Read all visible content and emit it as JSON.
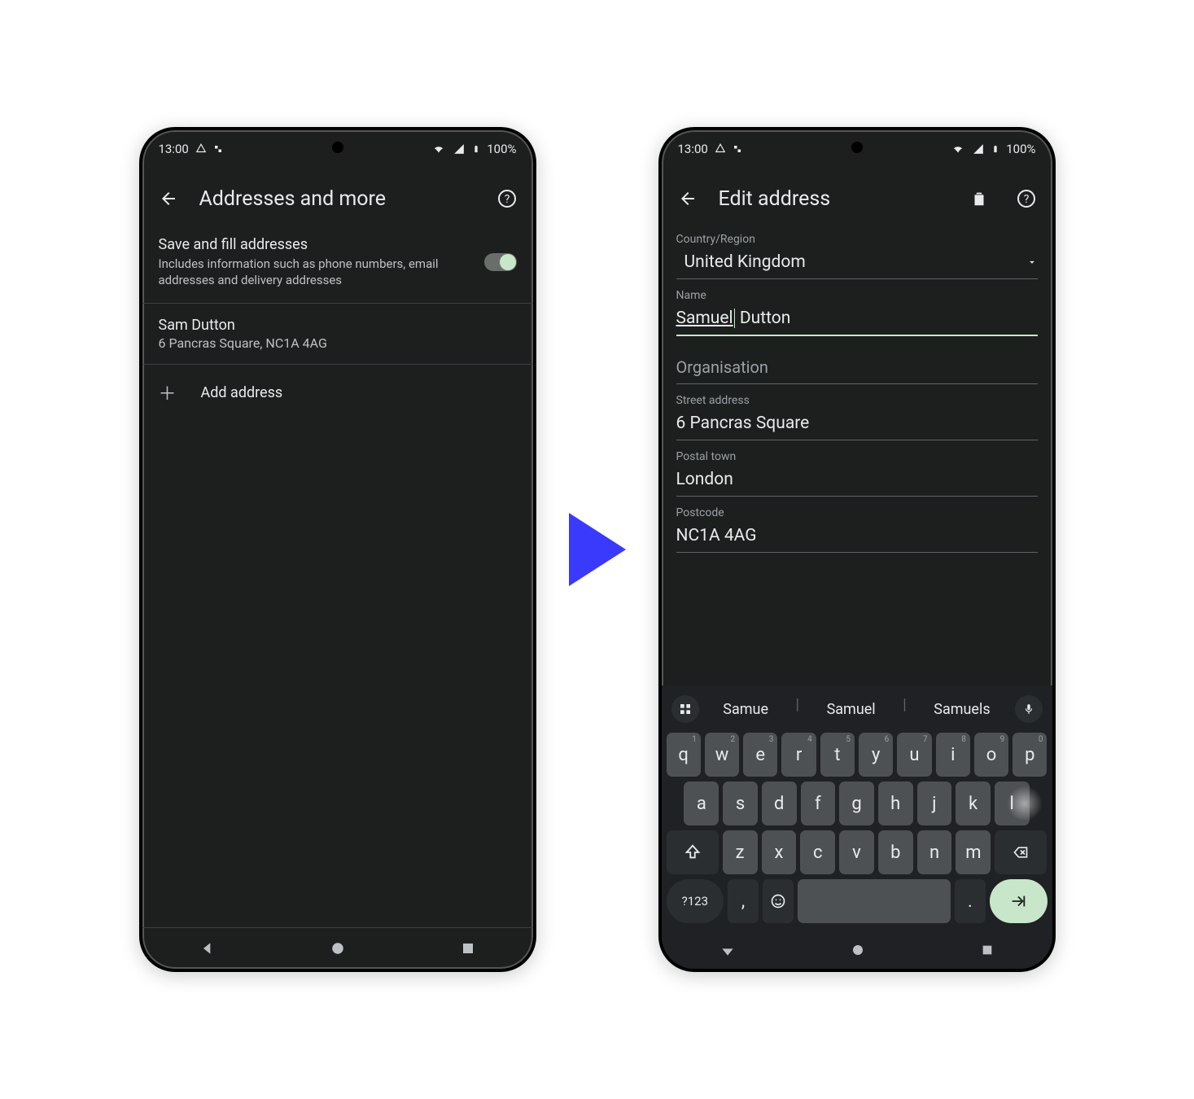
{
  "status": {
    "time": "13:00",
    "battery": "100%"
  },
  "left": {
    "title": "Addresses and more",
    "toggle": {
      "title": "Save and fill addresses",
      "sub": "Includes information such as phone numbers, email addresses and delivery addresses"
    },
    "address": {
      "name": "Sam Dutton",
      "line": "6 Pancras Square, NC1A 4AG"
    },
    "add_label": "Add address"
  },
  "right": {
    "title": "Edit address",
    "labels": {
      "country": "Country/Region",
      "name": "Name",
      "org_placeholder": "Organisation",
      "street": "Street address",
      "town": "Postal town",
      "postcode": "Postcode"
    },
    "values": {
      "country": "United Kingdom",
      "name_first": "Samuel",
      "name_rest": " Dutton",
      "street": "6 Pancras Square",
      "town": "London",
      "postcode": "NC1A 4AG"
    }
  },
  "keyboard": {
    "suggestions": [
      "Samue",
      "Samuel",
      "Samuels"
    ],
    "row1": [
      {
        "k": "q",
        "s": "1"
      },
      {
        "k": "w",
        "s": "2"
      },
      {
        "k": "e",
        "s": "3"
      },
      {
        "k": "r",
        "s": "4"
      },
      {
        "k": "t",
        "s": "5"
      },
      {
        "k": "y",
        "s": "6"
      },
      {
        "k": "u",
        "s": "7"
      },
      {
        "k": "i",
        "s": "8"
      },
      {
        "k": "o",
        "s": "9"
      },
      {
        "k": "p",
        "s": "0"
      }
    ],
    "row2": [
      "a",
      "s",
      "d",
      "f",
      "g",
      "h",
      "j",
      "k",
      "l"
    ],
    "row3": [
      "z",
      "x",
      "c",
      "v",
      "b",
      "n",
      "m"
    ],
    "numkey": "?123",
    "comma": ",",
    "period": "."
  }
}
